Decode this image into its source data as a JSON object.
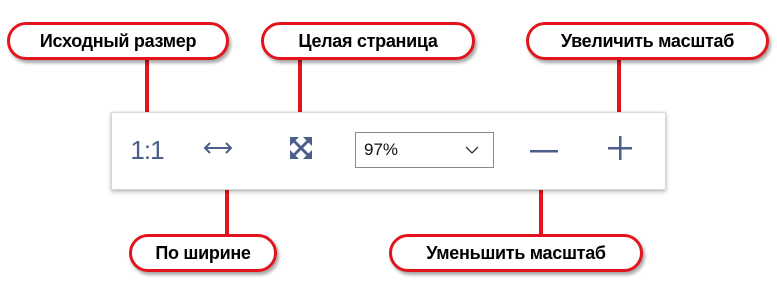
{
  "toolbar": {
    "actual_size_label": "1:1",
    "fit_width_icon": "horizontal-double-arrow-icon",
    "full_page_icon": "expand-arrows-icon",
    "zoom": {
      "value": "97%",
      "icon": "chevron-down-icon"
    },
    "zoom_out_icon": "minus-icon",
    "zoom_in_icon": "plus-icon",
    "icon_color": "#4b5f8a"
  },
  "callouts": {
    "actual_size": "Исходный размер",
    "full_page": "Целая страница",
    "zoom_in": "Увеличить масштаб",
    "fit_width": "По ширине",
    "zoom_out": "Уменьшить масштаб",
    "accent_color": "#e3141b"
  }
}
